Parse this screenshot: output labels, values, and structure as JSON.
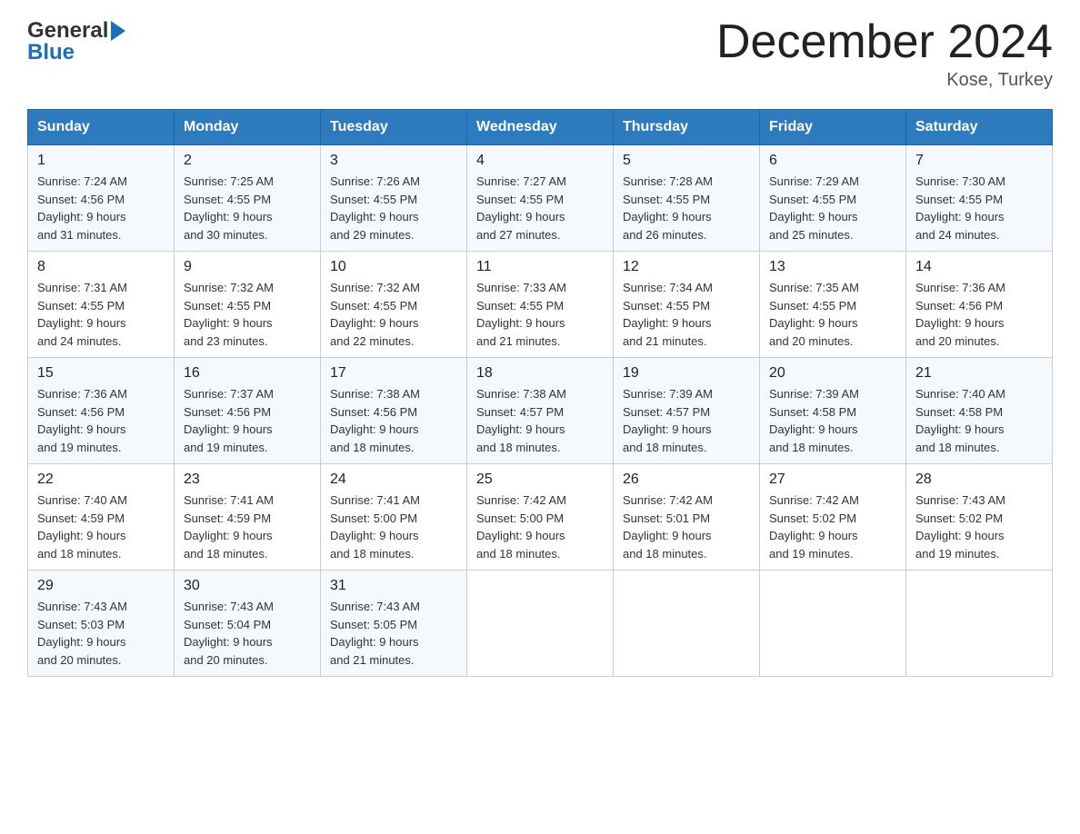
{
  "header": {
    "logo_general": "General",
    "logo_blue": "Blue",
    "month_title": "December 2024",
    "location": "Kose, Turkey"
  },
  "weekdays": [
    "Sunday",
    "Monday",
    "Tuesday",
    "Wednesday",
    "Thursday",
    "Friday",
    "Saturday"
  ],
  "weeks": [
    [
      {
        "num": "1",
        "sunrise": "7:24 AM",
        "sunset": "4:56 PM",
        "daylight": "9 hours and 31 minutes."
      },
      {
        "num": "2",
        "sunrise": "7:25 AM",
        "sunset": "4:55 PM",
        "daylight": "9 hours and 30 minutes."
      },
      {
        "num": "3",
        "sunrise": "7:26 AM",
        "sunset": "4:55 PM",
        "daylight": "9 hours and 29 minutes."
      },
      {
        "num": "4",
        "sunrise": "7:27 AM",
        "sunset": "4:55 PM",
        "daylight": "9 hours and 27 minutes."
      },
      {
        "num": "5",
        "sunrise": "7:28 AM",
        "sunset": "4:55 PM",
        "daylight": "9 hours and 26 minutes."
      },
      {
        "num": "6",
        "sunrise": "7:29 AM",
        "sunset": "4:55 PM",
        "daylight": "9 hours and 25 minutes."
      },
      {
        "num": "7",
        "sunrise": "7:30 AM",
        "sunset": "4:55 PM",
        "daylight": "9 hours and 24 minutes."
      }
    ],
    [
      {
        "num": "8",
        "sunrise": "7:31 AM",
        "sunset": "4:55 PM",
        "daylight": "9 hours and 24 minutes."
      },
      {
        "num": "9",
        "sunrise": "7:32 AM",
        "sunset": "4:55 PM",
        "daylight": "9 hours and 23 minutes."
      },
      {
        "num": "10",
        "sunrise": "7:32 AM",
        "sunset": "4:55 PM",
        "daylight": "9 hours and 22 minutes."
      },
      {
        "num": "11",
        "sunrise": "7:33 AM",
        "sunset": "4:55 PM",
        "daylight": "9 hours and 21 minutes."
      },
      {
        "num": "12",
        "sunrise": "7:34 AM",
        "sunset": "4:55 PM",
        "daylight": "9 hours and 21 minutes."
      },
      {
        "num": "13",
        "sunrise": "7:35 AM",
        "sunset": "4:55 PM",
        "daylight": "9 hours and 20 minutes."
      },
      {
        "num": "14",
        "sunrise": "7:36 AM",
        "sunset": "4:56 PM",
        "daylight": "9 hours and 20 minutes."
      }
    ],
    [
      {
        "num": "15",
        "sunrise": "7:36 AM",
        "sunset": "4:56 PM",
        "daylight": "9 hours and 19 minutes."
      },
      {
        "num": "16",
        "sunrise": "7:37 AM",
        "sunset": "4:56 PM",
        "daylight": "9 hours and 19 minutes."
      },
      {
        "num": "17",
        "sunrise": "7:38 AM",
        "sunset": "4:56 PM",
        "daylight": "9 hours and 18 minutes."
      },
      {
        "num": "18",
        "sunrise": "7:38 AM",
        "sunset": "4:57 PM",
        "daylight": "9 hours and 18 minutes."
      },
      {
        "num": "19",
        "sunrise": "7:39 AM",
        "sunset": "4:57 PM",
        "daylight": "9 hours and 18 minutes."
      },
      {
        "num": "20",
        "sunrise": "7:39 AM",
        "sunset": "4:58 PM",
        "daylight": "9 hours and 18 minutes."
      },
      {
        "num": "21",
        "sunrise": "7:40 AM",
        "sunset": "4:58 PM",
        "daylight": "9 hours and 18 minutes."
      }
    ],
    [
      {
        "num": "22",
        "sunrise": "7:40 AM",
        "sunset": "4:59 PM",
        "daylight": "9 hours and 18 minutes."
      },
      {
        "num": "23",
        "sunrise": "7:41 AM",
        "sunset": "4:59 PM",
        "daylight": "9 hours and 18 minutes."
      },
      {
        "num": "24",
        "sunrise": "7:41 AM",
        "sunset": "5:00 PM",
        "daylight": "9 hours and 18 minutes."
      },
      {
        "num": "25",
        "sunrise": "7:42 AM",
        "sunset": "5:00 PM",
        "daylight": "9 hours and 18 minutes."
      },
      {
        "num": "26",
        "sunrise": "7:42 AM",
        "sunset": "5:01 PM",
        "daylight": "9 hours and 18 minutes."
      },
      {
        "num": "27",
        "sunrise": "7:42 AM",
        "sunset": "5:02 PM",
        "daylight": "9 hours and 19 minutes."
      },
      {
        "num": "28",
        "sunrise": "7:43 AM",
        "sunset": "5:02 PM",
        "daylight": "9 hours and 19 minutes."
      }
    ],
    [
      {
        "num": "29",
        "sunrise": "7:43 AM",
        "sunset": "5:03 PM",
        "daylight": "9 hours and 20 minutes."
      },
      {
        "num": "30",
        "sunrise": "7:43 AM",
        "sunset": "5:04 PM",
        "daylight": "9 hours and 20 minutes."
      },
      {
        "num": "31",
        "sunrise": "7:43 AM",
        "sunset": "5:05 PM",
        "daylight": "9 hours and 21 minutes."
      },
      null,
      null,
      null,
      null
    ]
  ],
  "labels": {
    "sunrise_prefix": "Sunrise: ",
    "sunset_prefix": "Sunset: ",
    "daylight_prefix": "Daylight: "
  }
}
